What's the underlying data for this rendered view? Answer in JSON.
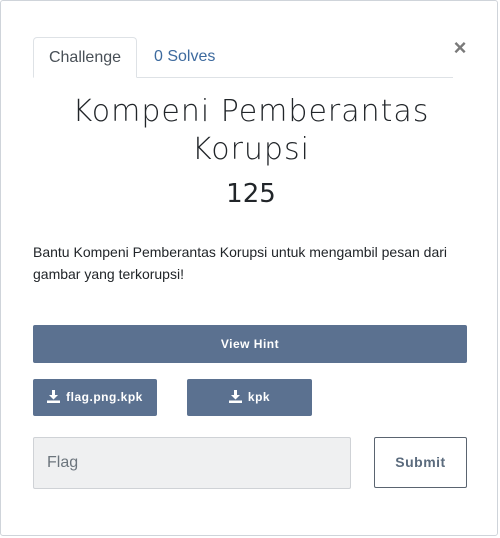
{
  "modal": {
    "close_symbol": "×",
    "tabs": [
      {
        "label": "Challenge",
        "active": true
      },
      {
        "label": "0 Solves",
        "active": false
      }
    ],
    "title": "Kompeni Pemberantas Korupsi",
    "points": "125",
    "description": "Bantu Kompeni Pemberantas Korupsi untuk mengambil pesan dari gambar yang terkorupsi!",
    "hint_button": "View Hint",
    "files": [
      {
        "label": "flag.png.kpk",
        "icon": "download-icon"
      },
      {
        "label": "kpk",
        "icon": "download-icon"
      }
    ],
    "flag_placeholder": "Flag",
    "submit_label": "Submit"
  },
  "colors": {
    "button_bg": "#5b7190",
    "tab_link": "#3d6a9e",
    "input_bg": "#eff0f1"
  }
}
